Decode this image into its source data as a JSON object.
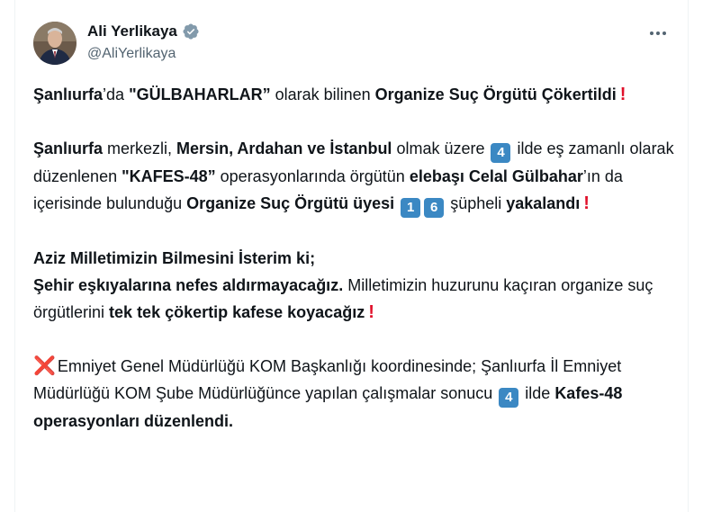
{
  "author": {
    "name": "Ali Yerlikaya",
    "handle": "@AliYerlikaya",
    "verified": true,
    "avatar_icon": "person-portrait"
  },
  "icons": {
    "more": "more-dots-icon",
    "verified": "verified-badge-icon"
  },
  "colors": {
    "verified": "#829aab",
    "exclamation": "#e0102a",
    "keycap": "#3b88c3",
    "cross": "#dd2e44"
  },
  "tweet": {
    "p1": {
      "s1": "Şanlıurfa",
      "s2": "’da ",
      "s3": "\"GÜLBAHARLAR”",
      "s4": " olarak bilinen ",
      "s5": "Organize Suç Örgütü Çökertildi",
      "exc": "!"
    },
    "p2": {
      "s1": "Şanlıurfa",
      "s2": " merkezli, ",
      "s3": "Mersin, Ardahan ve İstanbul",
      "s4": " olmak üzere ",
      "k1": "4",
      "s5": " ilde eş zamanlı olarak düzenlenen ",
      "s6": "\"KAFES-48”",
      "s7": " operasyonlarında örgütün ",
      "s8": "elebaşı Celal Gülbahar",
      "s9": "’ın da içerisinde bulunduğu ",
      "s10": "Organize Suç Örgütü üyesi",
      "k2": "1",
      "k3": "6",
      "s11": " şüpheli ",
      "s12": "yakalandı",
      "exc": "!"
    },
    "p3": {
      "s1": "Aziz Milletimizin Bilmesini İsterim ki;",
      "s2": "Şehir eşkıyalarına nefes aldırmayacağız.",
      "s3": " Milletimizin huzurunu kaçıran organize suç örgütlerini ",
      "s4": "tek tek çökertip kafese koyacağız",
      "exc": "!"
    },
    "p4": {
      "x": "❌",
      "s1": "Emniyet Genel Müdürlüğü KOM Başkanlığı koordinesinde; Şanlıurfa İl Emniyet Müdürlüğü KOM Şube Müdürlüğünce yapılan çalışmalar sonucu ",
      "k1": "4",
      "s2": " ilde ",
      "s3": "Kafes-48 operasyonları düzenlendi."
    }
  }
}
